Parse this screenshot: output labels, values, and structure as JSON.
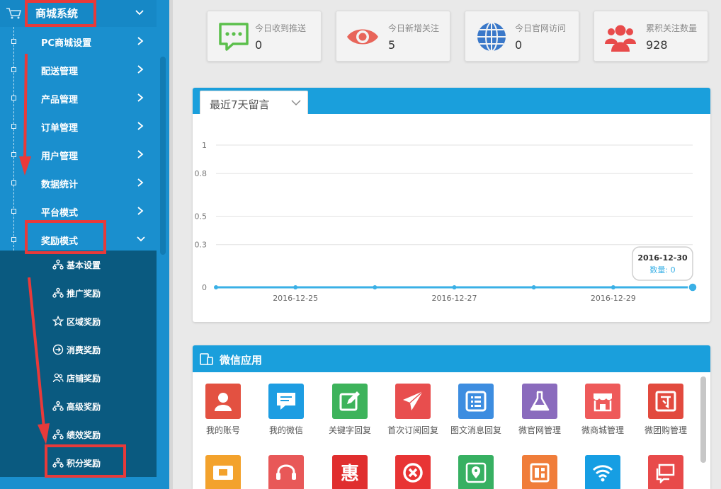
{
  "sidebar": {
    "top_label": "商城系统",
    "items": [
      {
        "label": "PC商城设置"
      },
      {
        "label": "配送管理"
      },
      {
        "label": "产品管理"
      },
      {
        "label": "订单管理"
      },
      {
        "label": "用户管理"
      },
      {
        "label": "数据统计"
      },
      {
        "label": "平台模式"
      },
      {
        "label": "奖励模式"
      }
    ],
    "sub_items": [
      {
        "label": "基本设置",
        "icon": "sitemap-icon"
      },
      {
        "label": "推广奖励",
        "icon": "sitemap-icon"
      },
      {
        "label": "区域奖励",
        "icon": "star-icon"
      },
      {
        "label": "消费奖励",
        "icon": "arrow-circle-icon"
      },
      {
        "label": "店铺奖励",
        "icon": "users-icon"
      },
      {
        "label": "高级奖励",
        "icon": "sitemap-icon"
      },
      {
        "label": "绩效奖励",
        "icon": "sitemap-icon"
      },
      {
        "label": "积分奖励",
        "icon": "sitemap-icon"
      }
    ],
    "colors": {
      "bg": "#1a8fce",
      "sub_bg": "#0a5a80",
      "highlight": "#e83a3a"
    }
  },
  "stats": [
    {
      "label": "今日收到推送",
      "value": "0",
      "icon": "chat-icon",
      "color": "#5bbf4b"
    },
    {
      "label": "今日新增关注",
      "value": "5",
      "icon": "eye-icon",
      "color": "#e8655a"
    },
    {
      "label": "今日官网访问",
      "value": "0",
      "icon": "globe-icon",
      "color": "#3a78c9"
    },
    {
      "label": "累积关注数量",
      "value": "928",
      "icon": "users-icon",
      "color": "#e84a4a"
    }
  ],
  "chart_panel": {
    "select_label": "最近7天留言"
  },
  "chart_data": {
    "type": "line",
    "x": [
      "2016-12-24",
      "2016-12-25",
      "2016-12-26",
      "2016-12-27",
      "2016-12-28",
      "2016-12-29",
      "2016-12-30"
    ],
    "x_tick_labels": [
      "2016-12-25",
      "2016-12-27",
      "2016-12-29"
    ],
    "y_tick_labels": [
      "1",
      "0.8",
      "0.5",
      "0.3",
      "0"
    ],
    "y_ticks": [
      1,
      0.8,
      0.5,
      0.3,
      0
    ],
    "series": [
      {
        "values": [
          0,
          0,
          0,
          0,
          0,
          0,
          0
        ],
        "color": "#3ab0e6"
      }
    ],
    "ylim": [
      0,
      1
    ],
    "grid": true,
    "tooltip": {
      "date": "2016-12-30",
      "label": "数量: 0"
    }
  },
  "apps_panel": {
    "title": "微信应用",
    "apps": [
      {
        "label": "我的账号",
        "icon": "user-icon",
        "color": "#e35141"
      },
      {
        "label": "我的微信",
        "icon": "message-icon",
        "color": "#1d9de2"
      },
      {
        "label": "关键字回复",
        "icon": "edit-icon",
        "color": "#3db35b"
      },
      {
        "label": "首次订阅回复",
        "icon": "paper-plane-icon",
        "color": "#e84e4e"
      },
      {
        "label": "图文消息回复",
        "icon": "list-icon",
        "color": "#3d8de0"
      },
      {
        "label": "微官网管理",
        "icon": "flask-icon",
        "color": "#8a6bbd"
      },
      {
        "label": "微商城管理",
        "icon": "store-icon",
        "color": "#ee5a5a"
      },
      {
        "label": "微团购管理",
        "icon": "group-buy-icon",
        "color": "#e24a3e"
      },
      {
        "label": "",
        "icon": "card-icon",
        "color": "#f3a22c"
      },
      {
        "label": "",
        "icon": "headset-icon",
        "color": "#e85858"
      },
      {
        "label": "",
        "icon": "hui-icon",
        "glyph": "惠",
        "color": "#e02e2e"
      },
      {
        "label": "",
        "icon": "close-circle-icon",
        "color": "#e83434"
      },
      {
        "label": "",
        "icon": "map-pin-icon",
        "color": "#37b062"
      },
      {
        "label": "",
        "icon": "grid-icon",
        "color": "#f07d3a"
      },
      {
        "label": "",
        "icon": "wifi-icon",
        "color": "#169ee3"
      },
      {
        "label": "",
        "icon": "chat-square-icon",
        "color": "#e84a4a"
      }
    ]
  }
}
